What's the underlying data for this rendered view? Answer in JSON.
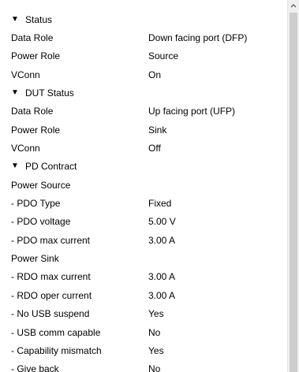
{
  "sections": [
    {
      "title": "Status",
      "rows": [
        {
          "key": "Data Role",
          "value": "Down facing port (DFP)"
        },
        {
          "key": "Power Role",
          "value": "Source"
        },
        {
          "key": "VConn",
          "value": "On"
        }
      ]
    },
    {
      "title": "DUT Status",
      "rows": [
        {
          "key": "Data Role",
          "value": "Up facing port (UFP)"
        },
        {
          "key": "Power Role",
          "value": "Sink"
        },
        {
          "key": "VConn",
          "value": "Off"
        }
      ]
    },
    {
      "title": "PD Contract",
      "groups": [
        {
          "title": "Power Source",
          "rows": [
            {
              "key": "- PDO Type",
              "value": "Fixed"
            },
            {
              "key": "- PDO voltage",
              "value": "5.00 V"
            },
            {
              "key": "- PDO max current",
              "value": "3.00 A"
            }
          ]
        },
        {
          "title": "Power Sink",
          "rows": [
            {
              "key": "- RDO max current",
              "value": "3.00 A"
            },
            {
              "key": "- RDO oper current",
              "value": "3.00 A"
            },
            {
              "key": "- No USB suspend",
              "value": "Yes"
            },
            {
              "key": "- USB comm capable",
              "value": "No"
            },
            {
              "key": "- Capability mismatch",
              "value": "Yes"
            },
            {
              "key": "- Give back",
              "value": "No"
            }
          ]
        }
      ]
    }
  ],
  "icons": {
    "expanded": "triangle-down-icon",
    "scroll_up": "chevron-up-icon"
  },
  "colors": {
    "background": "#ffffff",
    "scrollbar_track": "#f0f0f0",
    "scrollbar_thumb": "#cdcdcd"
  }
}
